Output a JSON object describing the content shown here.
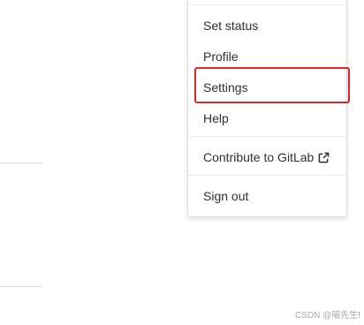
{
  "menu": {
    "set_status": "Set status",
    "profile": "Profile",
    "settings": "Settings",
    "help": "Help",
    "contribute": "Contribute to GitLab",
    "sign_out": "Sign out"
  },
  "icons": {
    "external_link": "external-link-icon"
  },
  "annotation": {
    "highlight_color": "#e0262b"
  },
  "watermark": "CSDN @喵先生!"
}
